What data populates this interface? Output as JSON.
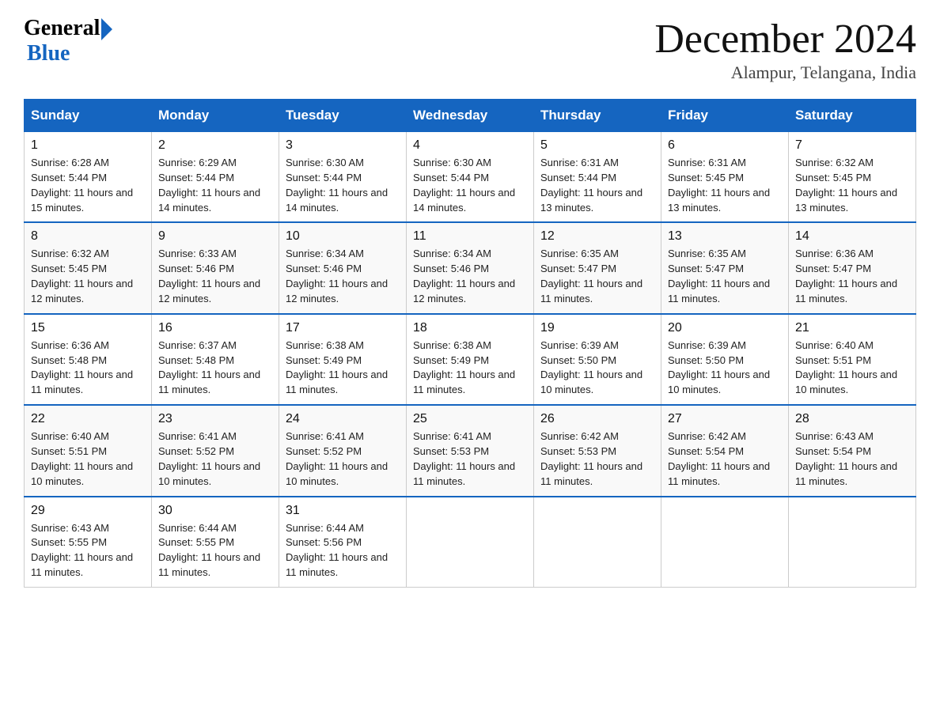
{
  "header": {
    "logo_general": "General",
    "logo_blue": "Blue",
    "month_title": "December 2024",
    "subtitle": "Alampur, Telangana, India"
  },
  "days_of_week": [
    "Sunday",
    "Monday",
    "Tuesday",
    "Wednesday",
    "Thursday",
    "Friday",
    "Saturday"
  ],
  "weeks": [
    [
      {
        "day": "1",
        "sunrise": "6:28 AM",
        "sunset": "5:44 PM",
        "daylight": "11 hours and 15 minutes."
      },
      {
        "day": "2",
        "sunrise": "6:29 AM",
        "sunset": "5:44 PM",
        "daylight": "11 hours and 14 minutes."
      },
      {
        "day": "3",
        "sunrise": "6:30 AM",
        "sunset": "5:44 PM",
        "daylight": "11 hours and 14 minutes."
      },
      {
        "day": "4",
        "sunrise": "6:30 AM",
        "sunset": "5:44 PM",
        "daylight": "11 hours and 14 minutes."
      },
      {
        "day": "5",
        "sunrise": "6:31 AM",
        "sunset": "5:44 PM",
        "daylight": "11 hours and 13 minutes."
      },
      {
        "day": "6",
        "sunrise": "6:31 AM",
        "sunset": "5:45 PM",
        "daylight": "11 hours and 13 minutes."
      },
      {
        "day": "7",
        "sunrise": "6:32 AM",
        "sunset": "5:45 PM",
        "daylight": "11 hours and 13 minutes."
      }
    ],
    [
      {
        "day": "8",
        "sunrise": "6:32 AM",
        "sunset": "5:45 PM",
        "daylight": "11 hours and 12 minutes."
      },
      {
        "day": "9",
        "sunrise": "6:33 AM",
        "sunset": "5:46 PM",
        "daylight": "11 hours and 12 minutes."
      },
      {
        "day": "10",
        "sunrise": "6:34 AM",
        "sunset": "5:46 PM",
        "daylight": "11 hours and 12 minutes."
      },
      {
        "day": "11",
        "sunrise": "6:34 AM",
        "sunset": "5:46 PM",
        "daylight": "11 hours and 12 minutes."
      },
      {
        "day": "12",
        "sunrise": "6:35 AM",
        "sunset": "5:47 PM",
        "daylight": "11 hours and 11 minutes."
      },
      {
        "day": "13",
        "sunrise": "6:35 AM",
        "sunset": "5:47 PM",
        "daylight": "11 hours and 11 minutes."
      },
      {
        "day": "14",
        "sunrise": "6:36 AM",
        "sunset": "5:47 PM",
        "daylight": "11 hours and 11 minutes."
      }
    ],
    [
      {
        "day": "15",
        "sunrise": "6:36 AM",
        "sunset": "5:48 PM",
        "daylight": "11 hours and 11 minutes."
      },
      {
        "day": "16",
        "sunrise": "6:37 AM",
        "sunset": "5:48 PM",
        "daylight": "11 hours and 11 minutes."
      },
      {
        "day": "17",
        "sunrise": "6:38 AM",
        "sunset": "5:49 PM",
        "daylight": "11 hours and 11 minutes."
      },
      {
        "day": "18",
        "sunrise": "6:38 AM",
        "sunset": "5:49 PM",
        "daylight": "11 hours and 11 minutes."
      },
      {
        "day": "19",
        "sunrise": "6:39 AM",
        "sunset": "5:50 PM",
        "daylight": "11 hours and 10 minutes."
      },
      {
        "day": "20",
        "sunrise": "6:39 AM",
        "sunset": "5:50 PM",
        "daylight": "11 hours and 10 minutes."
      },
      {
        "day": "21",
        "sunrise": "6:40 AM",
        "sunset": "5:51 PM",
        "daylight": "11 hours and 10 minutes."
      }
    ],
    [
      {
        "day": "22",
        "sunrise": "6:40 AM",
        "sunset": "5:51 PM",
        "daylight": "11 hours and 10 minutes."
      },
      {
        "day": "23",
        "sunrise": "6:41 AM",
        "sunset": "5:52 PM",
        "daylight": "11 hours and 10 minutes."
      },
      {
        "day": "24",
        "sunrise": "6:41 AM",
        "sunset": "5:52 PM",
        "daylight": "11 hours and 10 minutes."
      },
      {
        "day": "25",
        "sunrise": "6:41 AM",
        "sunset": "5:53 PM",
        "daylight": "11 hours and 11 minutes."
      },
      {
        "day": "26",
        "sunrise": "6:42 AM",
        "sunset": "5:53 PM",
        "daylight": "11 hours and 11 minutes."
      },
      {
        "day": "27",
        "sunrise": "6:42 AM",
        "sunset": "5:54 PM",
        "daylight": "11 hours and 11 minutes."
      },
      {
        "day": "28",
        "sunrise": "6:43 AM",
        "sunset": "5:54 PM",
        "daylight": "11 hours and 11 minutes."
      }
    ],
    [
      {
        "day": "29",
        "sunrise": "6:43 AM",
        "sunset": "5:55 PM",
        "daylight": "11 hours and 11 minutes."
      },
      {
        "day": "30",
        "sunrise": "6:44 AM",
        "sunset": "5:55 PM",
        "daylight": "11 hours and 11 minutes."
      },
      {
        "day": "31",
        "sunrise": "6:44 AM",
        "sunset": "5:56 PM",
        "daylight": "11 hours and 11 minutes."
      },
      null,
      null,
      null,
      null
    ]
  ]
}
